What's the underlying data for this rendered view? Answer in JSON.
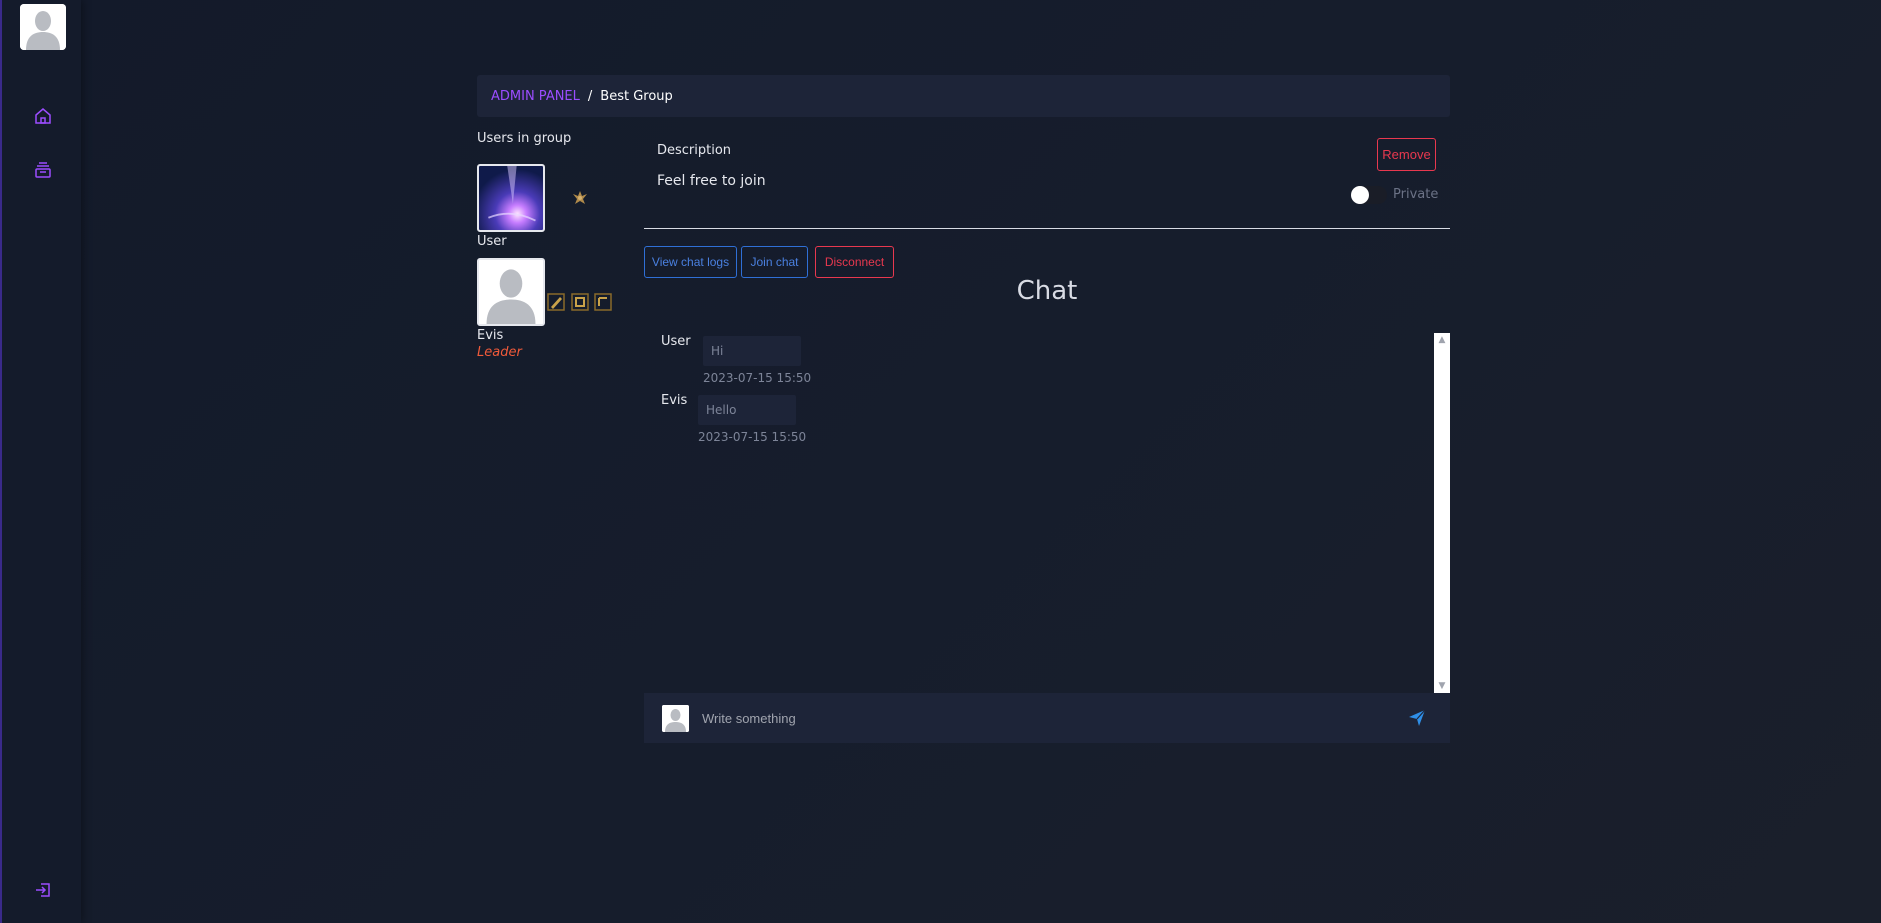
{
  "colors": {
    "accent_purple": "#9b4dff",
    "danger_red": "#e8384f",
    "link_blue": "#4a80e0",
    "leader_orange": "#f05a3a",
    "panel_bg": "#1d2438"
  },
  "sidebar": {
    "avatar_icon": "default-avatar-icon",
    "items": [
      {
        "icon": "home-icon"
      },
      {
        "icon": "groups-stack-icon"
      }
    ],
    "logout_icon": "logout-icon"
  },
  "breadcrumb": {
    "root": "ADMIN PANEL",
    "separator": "/",
    "current": "Best Group"
  },
  "users_panel": {
    "title": "Users in group",
    "users": [
      {
        "name": "User",
        "role": "",
        "avatar": "galaxy-avatar",
        "badge_icon": "crest-icon"
      },
      {
        "name": "Evis",
        "role": "Leader",
        "avatar": "default-avatar",
        "actions": [
          "edit-icon",
          "promote-icon",
          "kick-icon"
        ]
      }
    ]
  },
  "group": {
    "description_label": "Description",
    "description": "Feel free to join",
    "remove_label": "Remove",
    "private_label": "Private",
    "private_on": false
  },
  "actions": {
    "view_logs": "View chat logs",
    "join_chat": "Join chat",
    "disconnect": "Disconnect"
  },
  "chat": {
    "title": "Chat",
    "messages": [
      {
        "sender": "User",
        "text": "Hi",
        "time": "2023-07-15 15:50"
      },
      {
        "sender": "Evis",
        "text": "Hello",
        "time": "2023-07-15 15:50"
      }
    ],
    "composer_placeholder": "Write something",
    "send_icon": "send-icon"
  }
}
